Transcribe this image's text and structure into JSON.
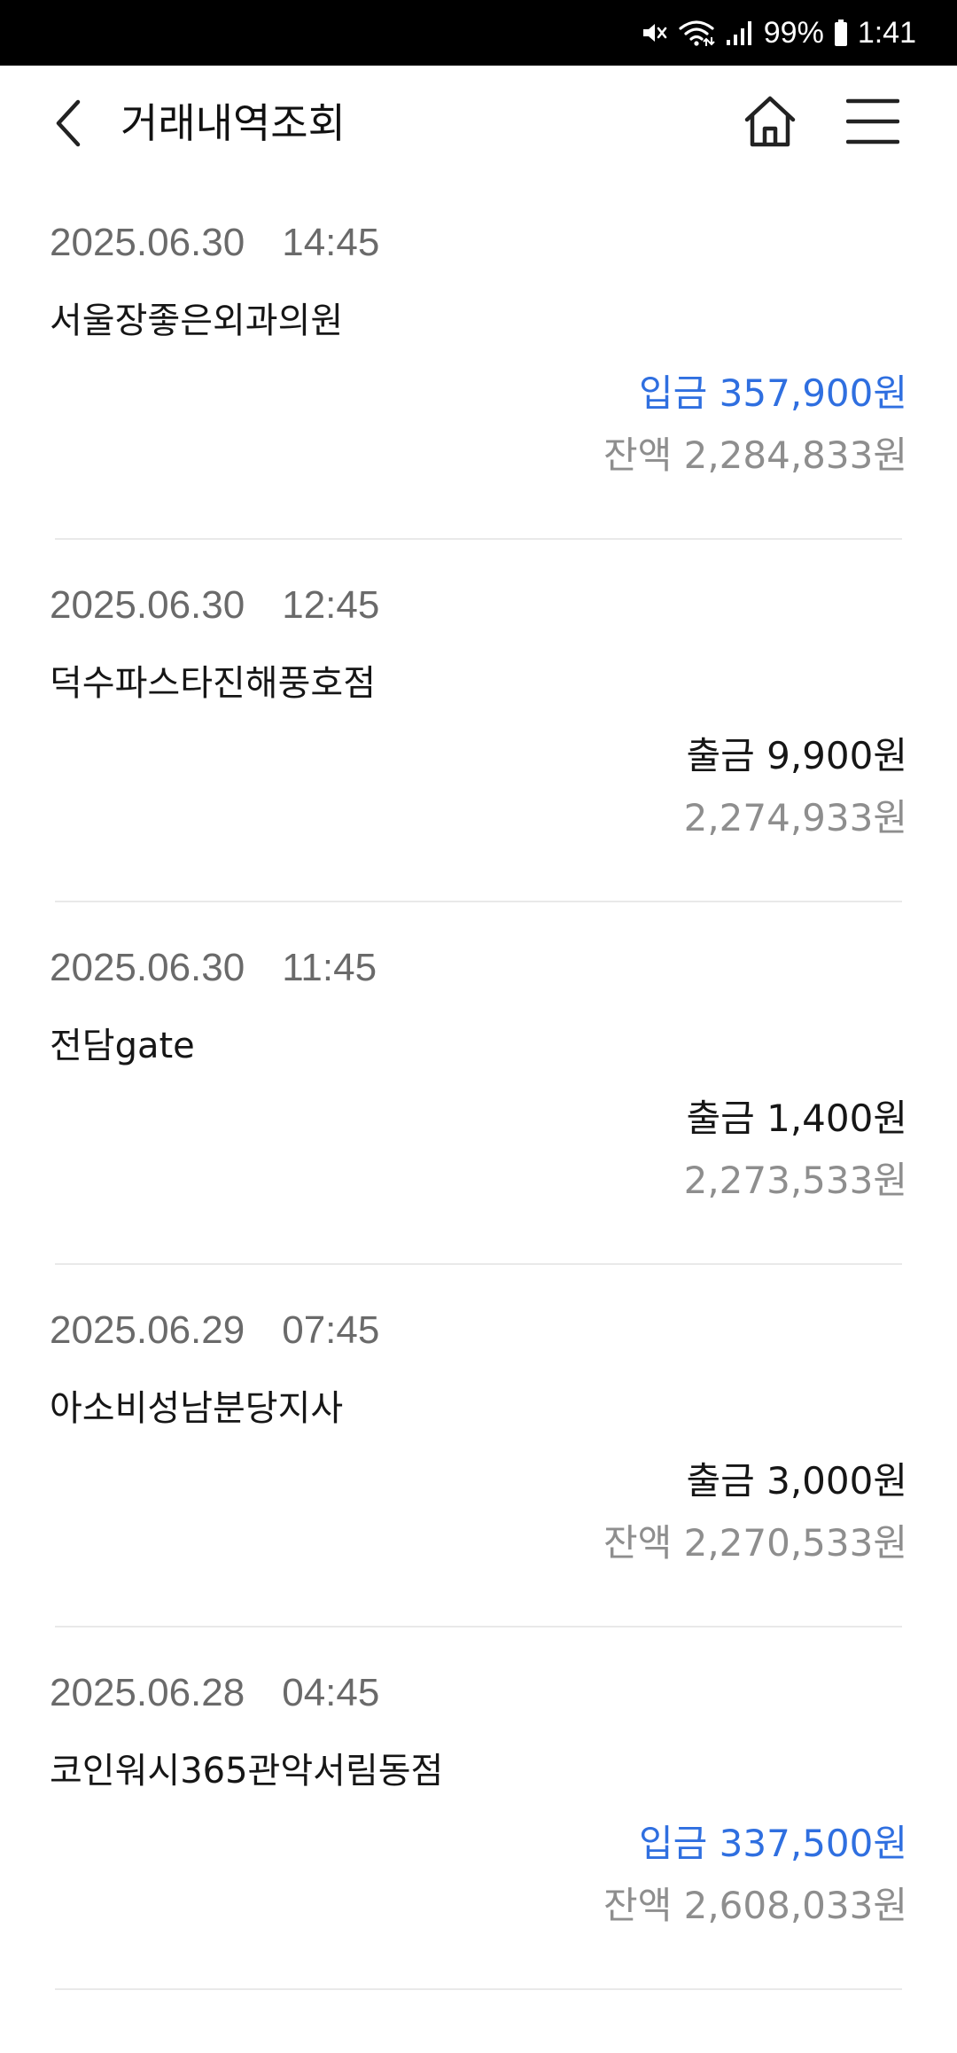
{
  "status_bar": {
    "battery_percent": "99%",
    "time": "1:41",
    "icons": [
      "mute-icon",
      "wifi-icon",
      "signal-icon",
      "battery-icon"
    ]
  },
  "header": {
    "title": "거래내역조회",
    "back_icon": "chevron-left-icon",
    "home_icon": "home-icon",
    "menu_icon": "hamburger-menu-icon"
  },
  "colors": {
    "deposit": "#2f6fe0",
    "withdraw": "#161616",
    "balance": "#8e8e8e",
    "datetime": "#6a6a6a"
  },
  "transactions": [
    {
      "date": "2025.06.30",
      "time": "14:45",
      "merchant": "서울장좋은외과의원",
      "type": "deposit",
      "amount": "입금 357,900원",
      "balance": "잔액 2,284,833원"
    },
    {
      "date": "2025.06.30",
      "time": "12:45",
      "merchant": "덕수파스타진해풍호점",
      "type": "withdraw",
      "amount": "출금 9,900원",
      "balance": "2,274,933원"
    },
    {
      "date": "2025.06.30",
      "time": "11:45",
      "merchant": "전담gate",
      "type": "withdraw",
      "amount": "출금 1,400원",
      "balance": "2,273,533원"
    },
    {
      "date": "2025.06.29",
      "time": "07:45",
      "merchant": "아소비성남분당지사",
      "type": "withdraw",
      "amount": "출금 3,000원",
      "balance": "잔액 2,270,533원"
    },
    {
      "date": "2025.06.28",
      "time": "04:45",
      "merchant": "코인워시365관악서림동점",
      "type": "deposit",
      "amount": "입금 337,500원",
      "balance": "잔액 2,608,033원"
    }
  ]
}
